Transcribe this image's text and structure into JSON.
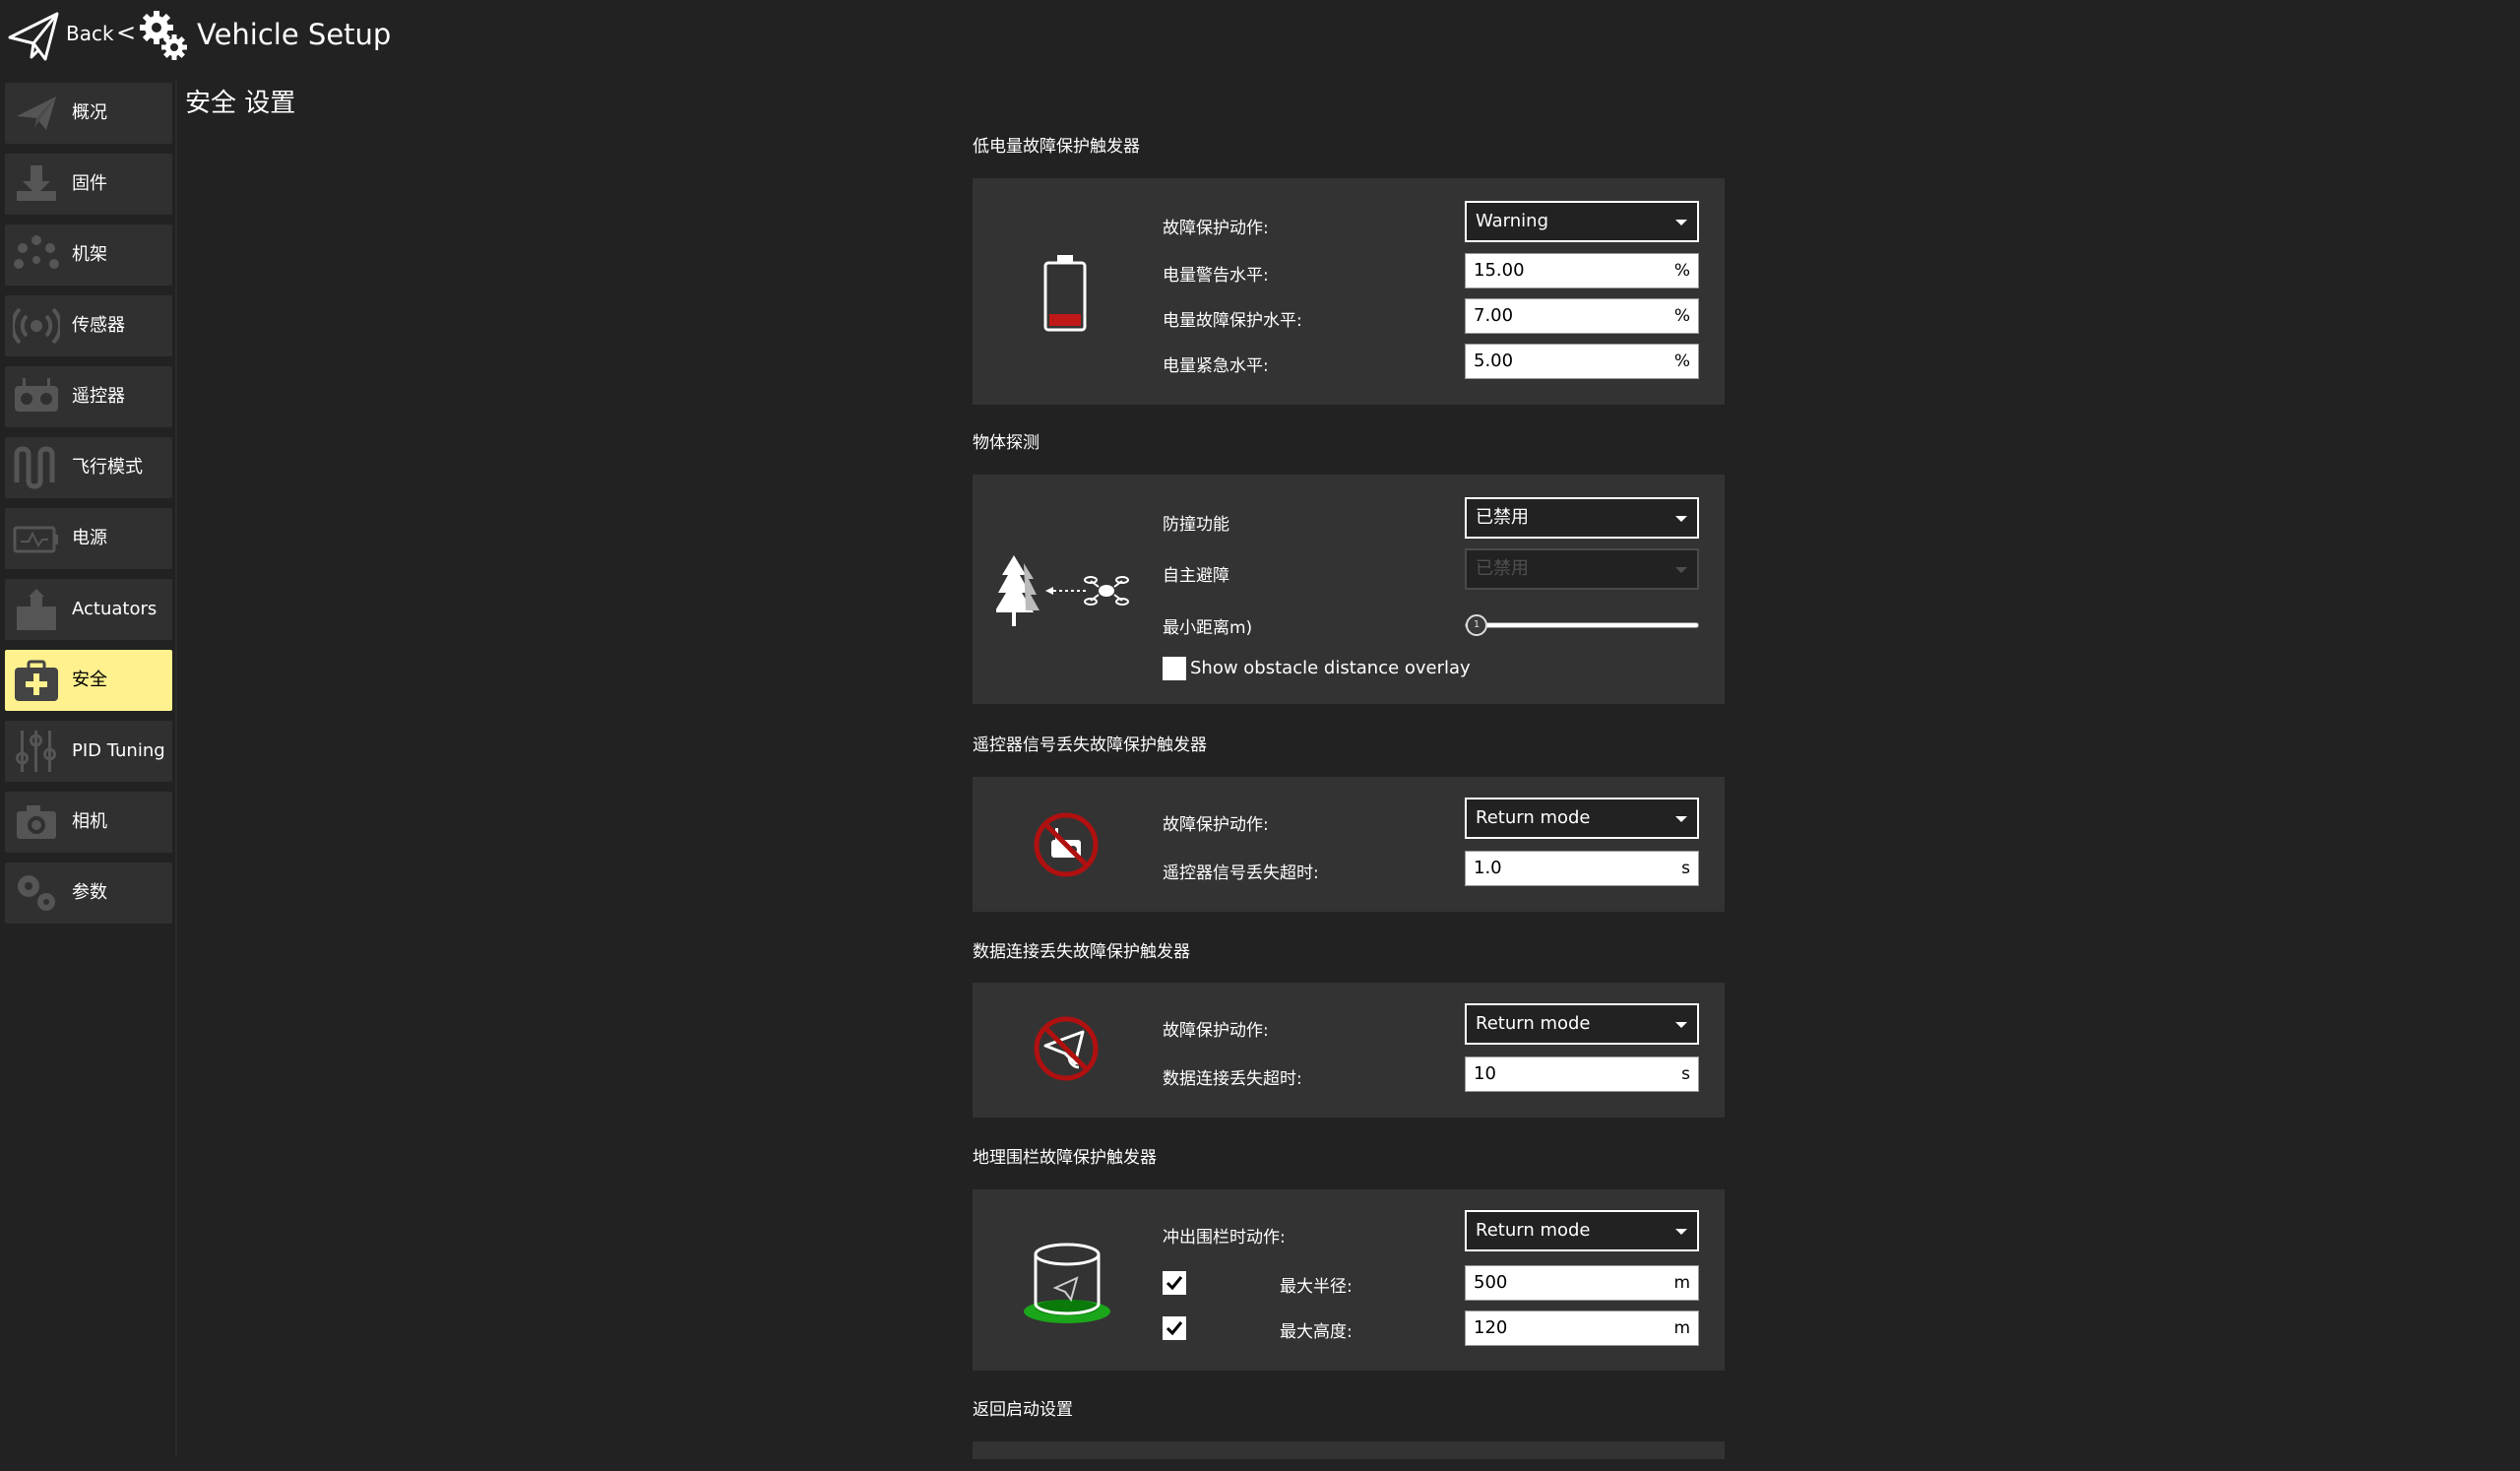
{
  "header": {
    "back_label": "Back",
    "separator": "<",
    "title": "Vehicle Setup"
  },
  "sidebar": {
    "items": [
      {
        "label": "概况",
        "icon": "plane-icon",
        "active": false
      },
      {
        "label": "固件",
        "icon": "firmware-download-icon",
        "active": false
      },
      {
        "label": "机架",
        "icon": "airframe-dots-icon",
        "active": false
      },
      {
        "label": "传感器",
        "icon": "sensor-radio-icon",
        "active": false
      },
      {
        "label": "遥控器",
        "icon": "remote-controller-icon",
        "active": false
      },
      {
        "label": "飞行模式",
        "icon": "flight-modes-wave-icon",
        "active": false
      },
      {
        "label": "电源",
        "icon": "power-battery-icon",
        "active": false
      },
      {
        "label": "Actuators",
        "icon": "actuator-icon",
        "active": false
      },
      {
        "label": "安全",
        "icon": "safety-medkit-icon",
        "active": true
      },
      {
        "label": "PID Tuning",
        "icon": "pid-sliders-icon",
        "active": false
      },
      {
        "label": "相机",
        "icon": "camera-icon",
        "active": false
      },
      {
        "label": "参数",
        "icon": "parameters-gears-icon",
        "active": false
      }
    ],
    "active_color": "#fef18e"
  },
  "main": {
    "title": "安全 设置",
    "low_battery": {
      "section_title": "低电量故障保护触发器",
      "action_label": "故障保护动作:",
      "action_value": "Warning",
      "warn_label": "电量警告水平:",
      "warn_value": "15.00",
      "warn_unit": "%",
      "failsafe_label": "电量故障保护水平:",
      "failsafe_value": "7.00",
      "failsafe_unit": "%",
      "emergency_label": "电量紧急水平:",
      "emergency_value": "5.00",
      "emergency_unit": "%"
    },
    "object_detection": {
      "section_title": "物体探测",
      "collision_label": "防撞功能",
      "collision_value": "已禁用",
      "avoid_label": "自主避障",
      "avoid_value": "已禁用",
      "min_dist_label": "最小距离m)",
      "slider_value": "1",
      "overlay_label": "Show obstacle distance overlay",
      "overlay_checked": false
    },
    "rc_loss": {
      "section_title": "遥控器信号丢失故障保护触发器",
      "action_label": "故障保护动作:",
      "action_value": "Return mode",
      "timeout_label": "遥控器信号丢失超时:",
      "timeout_value": "1.0",
      "timeout_unit": "s"
    },
    "data_link_loss": {
      "section_title": "数据连接丢失故障保护触发器",
      "action_label": "故障保护动作:",
      "action_value": "Return mode",
      "timeout_label": "数据连接丢失超时:",
      "timeout_value": "10",
      "timeout_unit": "s"
    },
    "geofence": {
      "section_title": "地理围栏故障保护触发器",
      "breach_label": "冲出围栏时动作:",
      "breach_value": "Return mode",
      "max_radius_label": "最大半径:",
      "max_radius_checked": true,
      "max_radius_value": "500",
      "max_radius_unit": "m",
      "max_alt_label": "最大高度:",
      "max_alt_checked": true,
      "max_alt_value": "120",
      "max_alt_unit": "m"
    },
    "return_launch": {
      "section_title": "返回启动设置"
    }
  }
}
